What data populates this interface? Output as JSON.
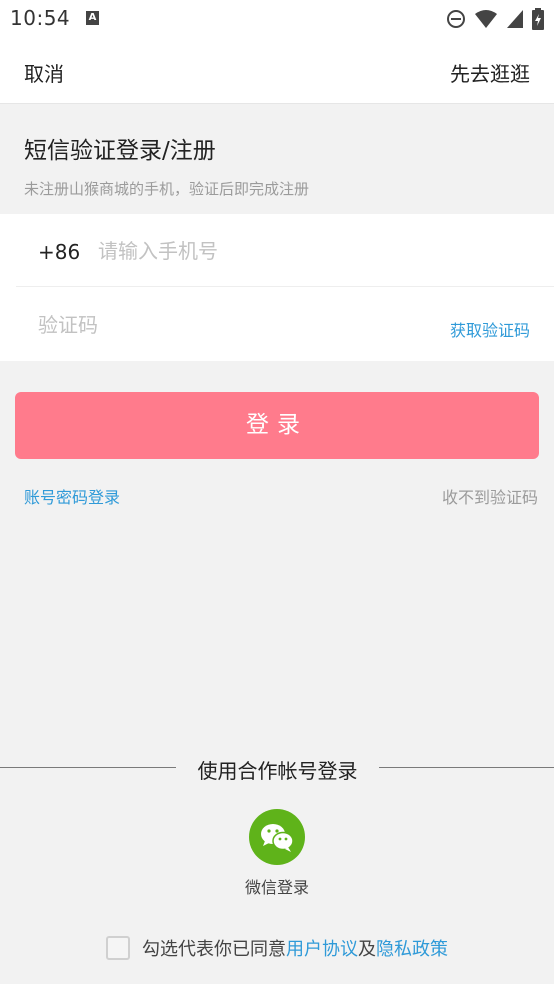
{
  "status_bar": {
    "time": "10:54",
    "icons": [
      "notification-a-icon",
      "do-not-disturb-icon",
      "wifi-icon",
      "signal-icon",
      "battery-icon"
    ]
  },
  "top_bar": {
    "cancel_label": "取消",
    "browse_label": "先去逛逛"
  },
  "header": {
    "title": "短信验证登录/注册",
    "subtitle": "未注册山猴商城的手机，验证后即完成注册"
  },
  "form": {
    "country_code": "+86",
    "phone_placeholder": "请输入手机号",
    "code_placeholder": "验证码",
    "get_code_label": "获取验证码"
  },
  "login_button_label": "登录",
  "links": {
    "password_login": "账号密码登录",
    "no_code": "收不到验证码"
  },
  "partner": {
    "title": "使用合作帐号登录",
    "wechat_label": "微信登录"
  },
  "agreement": {
    "prefix": "勾选代表你已同意",
    "user_agreement": "用户协议",
    "joiner": "及",
    "privacy_policy": "隐私政策"
  },
  "colors": {
    "accent_link": "#2f9ad8",
    "login_button": "#ff7b8c",
    "wechat_green": "#5fb31a"
  }
}
